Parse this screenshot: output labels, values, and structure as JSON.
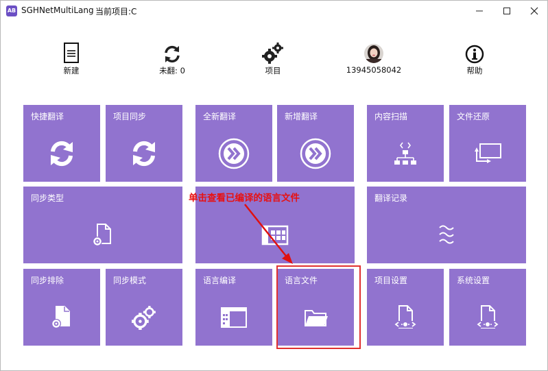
{
  "titlebar": {
    "app_icon_text": "AB",
    "app_name": "SGHNetMultiLang",
    "project_label": "当前项目:C"
  },
  "toolbar": {
    "new_label": "新建",
    "untranslated_label": "未翻: 0",
    "project_label": "项目",
    "user_phone": "13945058042",
    "help_label": "帮助"
  },
  "tiles": {
    "quick_translate": "快捷翻译",
    "project_sync": "项目同步",
    "full_translate": "全新翻译",
    "add_translate": "新增翻译",
    "content_scan": "内容扫描",
    "file_restore": "文件还原",
    "sync_type": "同步类型",
    "middle_hidden": "",
    "translate_log": "翻译记录",
    "sync_exclude": "同步排除",
    "sync_mode": "同步模式",
    "lang_compile": "语言编译",
    "lang_file": "语言文件",
    "project_settings": "项目设置",
    "system_settings": "系统设置"
  },
  "annotation": {
    "text": "单击查看已编译的语言文件",
    "color": "#e81010"
  },
  "colors": {
    "tile": "#9173cf",
    "accent": "#6b4fc4"
  }
}
